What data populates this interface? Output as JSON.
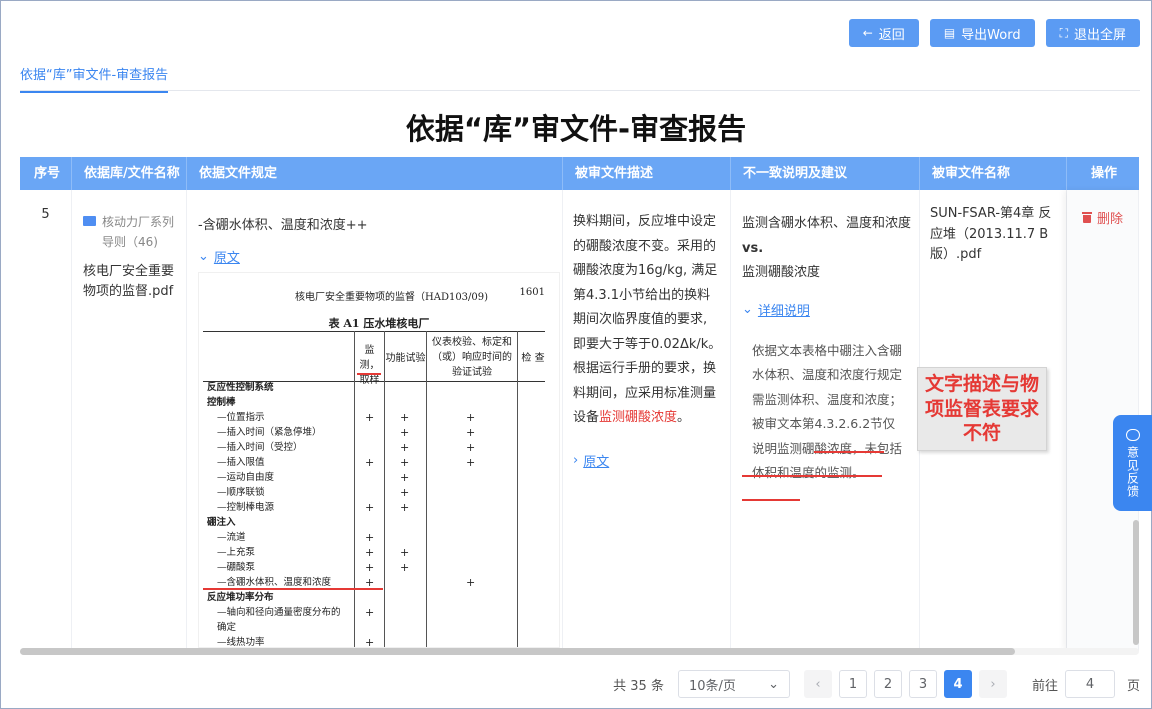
{
  "toolbar": {
    "back": "返回",
    "export": "导出Word",
    "exit_fullscreen": "退出全屏"
  },
  "tab": {
    "label": "依据“库”审文件-审查报告"
  },
  "report_title": "依据“库”审文件-审查报告",
  "table": {
    "headers": [
      "序号",
      "依据库/文件名称",
      "依据文件规定",
      "被审文件描述",
      "不一致说明及建议",
      "被审文件名称",
      "操作"
    ],
    "row": {
      "index": "5",
      "library_folder": "核动力厂系列导则（46)",
      "library_file": "核电厂安全重要物项的监督.pdf",
      "rule_text": "-含硼水体积、温度和浓度++",
      "rule_toggle": "原文",
      "desc_text": "换料期间，反应堆中设定的硼酸浓度不变。采用的硼酸浓度为16g/kg, 满足第4.3.1小节给出的换料期间次临界度值的要求, 即要大于等于0.02Δk/k。根据运行手册的要求，换料期间，应采用标准测量设备",
      "desc_highlight": "监测硼酸浓度",
      "desc_end": "。",
      "desc_toggle": "原文",
      "sugg_line1": "监测含硼水体积、温度和浓度",
      "sugg_vs": "vs.",
      "sugg_line2": "监测硼酸浓度",
      "sugg_toggle": "详细说明",
      "sugg_detail": "依据文本表格中硼注入含硼水体积、温度和浓度行规定需监测体积、温度和浓度；被审文本第4.3.2.6.2节仅说明监测硼酸浓度，未包括体积和温度的监测。",
      "doc_name": "SUN-FSAR-第4章 反应堆（2013.11.7 B版）.pdf",
      "delete": "删除"
    }
  },
  "scan": {
    "header": "核电厂安全重要物项的监督（HAD103/09)",
    "page": "1601",
    "table_title": "表 A1   压水堆核电厂",
    "col1": "监测，\n取样",
    "col2": "功能试验",
    "col3": "仪表校验、标定和\n（或）响应时间的\n验证试验",
    "col4": "检  查",
    "rows": [
      "反应性控制系统",
      "控制棒",
      "—位置指示",
      "—插入时间（紧急停堆）",
      "—插入时间（受控）",
      "—插入限值",
      "—运动自由度",
      "—顺序联锁",
      "—控制棒电源",
      "硼注入",
      "—流道",
      "—上充泵",
      "—硼酸泵",
      "—含硼水体积、温度和浓度",
      "反应堆功率分布",
      "—轴向和径向通量密度分布的",
      "  确定",
      "—线热功率"
    ]
  },
  "callout": "文字描述与物项监督表要求不符",
  "feedback": "意见反馈",
  "pager": {
    "total": "共 35 条",
    "page_size": "10条/页",
    "pages": [
      "1",
      "2",
      "3",
      "4"
    ],
    "current": "4",
    "jump_label": "前往",
    "jump_value": "4",
    "jump_suffix": "页"
  }
}
